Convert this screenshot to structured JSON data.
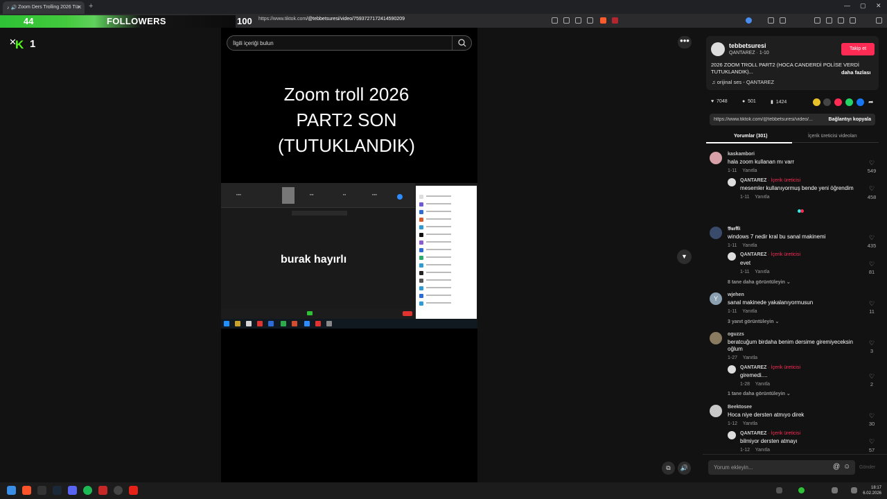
{
  "browser": {
    "tab_title": "Zoom Ders Trolling 2026 Tür",
    "url_prefix": "https://www.tiktok.com",
    "url_path": "/@tebbetsuresi/video/7593727172414590209"
  },
  "stream_overlay": {
    "followers_count": "44",
    "followers_label": "FOLLOWERS",
    "followers_goal": "100",
    "kick_viewers": "1"
  },
  "search": {
    "placeholder": "İlgili içeriği bulun"
  },
  "video": {
    "title_lines": [
      "Zoom troll 2026",
      "PART2 SON",
      "(TUTUKLANDIK)"
    ],
    "caption": "burak hayırlı"
  },
  "post": {
    "author": "tebbetsuresi",
    "author_sub": "QANTAREZ · 1-10",
    "follow_label": "Takip et",
    "description": "2026 ZOOM TROLL PART2 (HOCA CANDERDİ POLİSE VERDİ TUTUKLANDIK)...",
    "more_label": "daha fazlası",
    "music": "orijinal ses - QANTAREZ",
    "likes": "7048",
    "comments": "501",
    "saves": "1424",
    "link": "https://www.tiktok.com/@tebbetsuresi/video/...",
    "copy_link_label": "Bağlantıyı kopyala"
  },
  "tabs": {
    "comments": "Yorumlar (301)",
    "creator_videos": "İçerik üreticisi videoları"
  },
  "labels": {
    "reply": "Yanıtla",
    "creator_badge": "· İçerik üreticisi"
  },
  "comments": [
    {
      "user": "kaskambori",
      "text": "hala zoom kullanan mı varr",
      "date": "1-11",
      "likes": "549",
      "reply": {
        "user": "QANTAREZ",
        "text": "mesemler kullanıyormuş bende yeni öğrendim",
        "date": "1-11",
        "likes": "458"
      }
    },
    {
      "user": "𝕭𝖚𝖗𝕬𝖎",
      "text": "windows 7 nedir kral bu sanal makinemi",
      "date": "1-11",
      "likes": "435",
      "reply": {
        "user": "QANTAREZ",
        "text": "evet",
        "date": "1-11",
        "likes": "81"
      },
      "view_more": "8 tane daha görüntüleyin"
    },
    {
      "user": "wjehen",
      "text": "sanal makinede yakalanıyormusun",
      "date": "1-11",
      "likes": "11",
      "view_more": "3 yanıt görüntüleyin"
    },
    {
      "user": "oguzzs",
      "text": "beratcuğum birdaha benim dersime giremiyeceksin oğlum",
      "date": "1-27",
      "likes": "3",
      "reply": {
        "user": "QANTAREZ",
        "text": "giremedi....",
        "date": "1-28",
        "likes": "2"
      },
      "view_more": "1 tane daha görüntüleyin"
    },
    {
      "user": "Beektosee",
      "text": "Hoca niye dersten atmıyo direk",
      "date": "1-12",
      "likes": "30",
      "reply": {
        "user": "QANTAREZ",
        "text": "bilmiyor dersten atmayı",
        "date": "1-12",
        "likes": "57"
      }
    }
  ],
  "add_comment": {
    "placeholder": "Yorum ekleyin...",
    "post_label": "Gönder"
  },
  "clock": {
    "time": "18:17",
    "date": "6.02.2026"
  },
  "colors": {
    "brand_red": "#fe2c55",
    "kick_green": "#53fc18",
    "overlay_green": "#43c93c"
  }
}
